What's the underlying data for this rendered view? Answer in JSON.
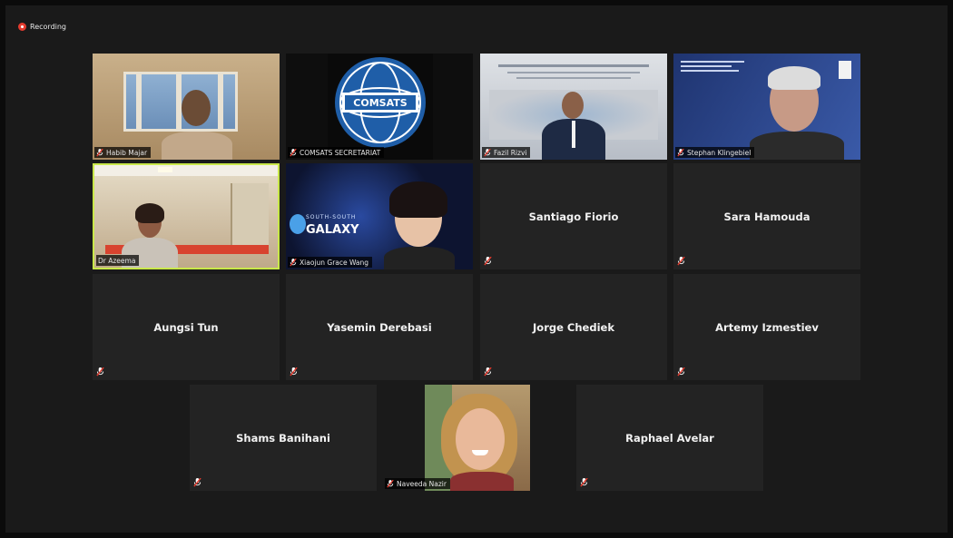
{
  "recording": {
    "label": "Recording",
    "color": "#e33b2e"
  },
  "active_speaker_color": "#c9e84a",
  "video_tiles": {
    "habib": {
      "name": "Habib Majar"
    },
    "comsats": {
      "name": "COMSATS SECRETARIAT",
      "logo_text": "COMSATS"
    },
    "fazil": {
      "name": "Fazil Rizvi"
    },
    "stephan": {
      "name": "Stephan Klingebiel"
    },
    "azeema": {
      "name": "Dr Azeema"
    },
    "xiaojun": {
      "name": "Xiaojun Grace Wang",
      "banner_line1": "SOUTH-SOUTH",
      "banner_line2": "GALAXY"
    },
    "naveeda": {
      "name": "Naveeda Nazir"
    }
  },
  "name_tiles": [
    {
      "name": "Santiago Fiorio"
    },
    {
      "name": "Sara Hamouda"
    },
    {
      "name": "Aungsi Tun"
    },
    {
      "name": "Yasemin Derebasi"
    },
    {
      "name": "Jorge Chediek"
    },
    {
      "name": "Artemy Izmestiev"
    },
    {
      "name": "Shams Banihani"
    },
    {
      "name": "Raphael Avelar"
    }
  ]
}
